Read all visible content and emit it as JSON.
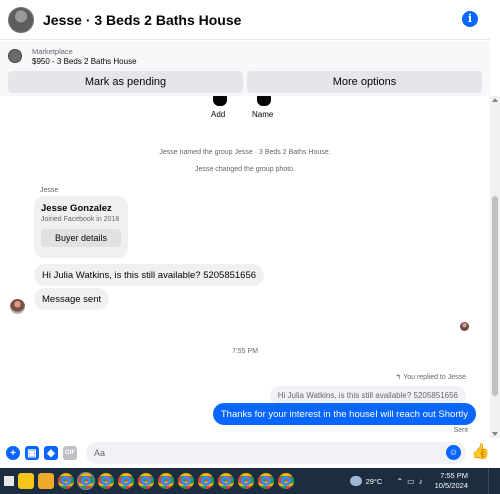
{
  "header": {
    "title": "Jesse · 3 Beds 2 Baths House",
    "info_glyph": "i"
  },
  "marketplace": {
    "label": "Marketplace",
    "listing": "$950 - 3 Beds 2 Baths House"
  },
  "actions": {
    "mark_pending": "Mark as pending",
    "more_options": "More options"
  },
  "chat": {
    "add_label": "Add",
    "name_label": "Name",
    "system_messages": [
      "Jesse named the group Jesse · 3 Beds 2 Baths House.",
      "Jesse changed the group photo."
    ],
    "sender_name": "Jesse",
    "buyer_card": {
      "name": "Jesse Gonzalez",
      "joined": "Joined Facebook in 2018",
      "details_button": "Buyer details"
    },
    "incoming": [
      "Hi Julia Watkins, is this still available? 5205851656",
      "Message sent"
    ],
    "timestamp": "7:55 PM",
    "reply_indicator": "You replied to Jesse",
    "quoted_message": "Hi Julia Watkins, is this still available? 5205851656",
    "outgoing_message": "Thanks for your interest in the houseI will reach out Shortly",
    "status": "Sent"
  },
  "composer": {
    "placeholder": "Aa",
    "gif_label": "GIF"
  },
  "taskbar": {
    "temperature": "29°C",
    "time": "7:55 PM",
    "date": "10/5/2024",
    "weather_icon": "cloud-icon",
    "app_icons": [
      "yellow-app-icon",
      "folder-icon",
      "chrome-icon"
    ]
  },
  "colors": {
    "accent": "#0866ff",
    "bubble_incoming": "#f0f0f0",
    "taskbar": "#1c2d3f"
  }
}
